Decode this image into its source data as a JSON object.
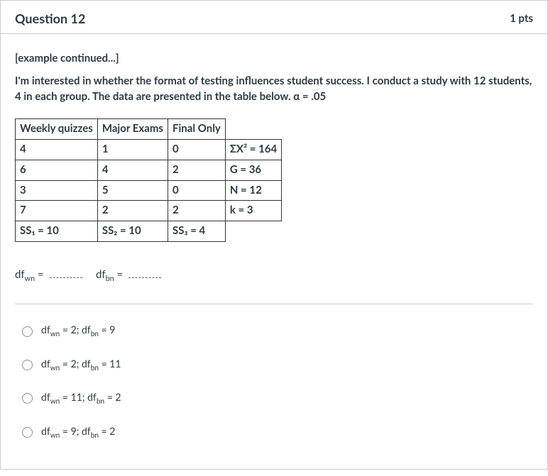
{
  "header": {
    "title": "Question 12",
    "points": "1 pts"
  },
  "lead": "[example continued...]",
  "intro_html": "I'm interested in whether the format of testing influences student success.  I conduct a study with 12 students, 4 in each group.  The data are presented in the table below.  α = .05",
  "table": {
    "headers": [
      "Weekly quizzes",
      "Major Exams",
      "Final Only"
    ],
    "rows": [
      [
        "4",
        "1",
        "0"
      ],
      [
        "6",
        "4",
        "2"
      ],
      [
        "3",
        "5",
        "0"
      ],
      [
        "7",
        "2",
        "2"
      ]
    ],
    "ss": {
      "1": "SS₁ = 10",
      "2": "SS₂ = 10",
      "3": "SS₃ = 4"
    },
    "stats": [
      "ΣX² = 164",
      "G = 36",
      "N = 12",
      "k = 3"
    ]
  },
  "prompt": {
    "prefix1": "df",
    "sub1": "wn",
    "eq1": " = ",
    "prefix2": "df",
    "sub2": "bn",
    "eq2": " = "
  },
  "options": [
    {
      "wn": "2",
      "bn": "9"
    },
    {
      "wn": "2",
      "bn": "11"
    },
    {
      "wn": "11",
      "bn": "2"
    },
    {
      "wn": "9",
      "bn": "2"
    }
  ]
}
